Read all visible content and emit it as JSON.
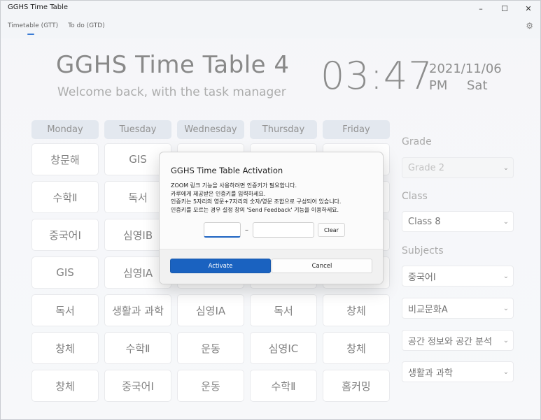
{
  "window": {
    "title": "GGHS Time Table",
    "minimize": "–",
    "maximize": "☐",
    "close": "✕"
  },
  "nav": {
    "tabs": [
      {
        "label": "Timetable (GTT)"
      },
      {
        "label": "To do (GTD)"
      }
    ],
    "settings_icon": "⚙"
  },
  "header": {
    "title": "GGHS Time Table 4",
    "subtitle": "Welcome back, with the task manager",
    "time": "03:47",
    "date": "2021/11/06",
    "ampm": "PM",
    "weekday": "Sat"
  },
  "timetable": {
    "days": [
      "Monday",
      "Tuesday",
      "Wednesday",
      "Thursday",
      "Friday"
    ],
    "rows": [
      [
        "창문해",
        "GIS",
        "",
        "",
        ""
      ],
      [
        "수학Ⅱ",
        "독서",
        "",
        "",
        ""
      ],
      [
        "중국어Ⅰ",
        "심영ⅠB",
        "",
        "",
        ""
      ],
      [
        "GIS",
        "심영ⅠA",
        "",
        "",
        ""
      ],
      [
        "독서",
        "생활과 과학",
        "심영ⅠA",
        "독서",
        "창체"
      ],
      [
        "창체",
        "수학Ⅱ",
        "운동",
        "심영ⅠC",
        "창체"
      ],
      [
        "창체",
        "중국어Ⅰ",
        "운동",
        "수학Ⅱ",
        "홈커밍"
      ]
    ]
  },
  "panel": {
    "grade_label": "Grade",
    "grade_value": "Grade 2",
    "class_label": "Class",
    "class_value": "Class 8",
    "subjects_label": "Subjects",
    "subjects": [
      "중국어Ⅰ",
      "비교문화A",
      "공간 정보와 공간 분석",
      "생활과 과학"
    ],
    "chevron": "⌄"
  },
  "dialog": {
    "title": "GGHS Time Table Activation",
    "lines": [
      "ZOOM 링크 기능을 사용하려면 인증키가 필요합니다.",
      "카루에게 제공받은 인증키를 입력하세요.",
      "인증키는 5자리의 영문+7자리의 숫자/영문 조합으로 구성되어 있습니다.",
      "인증키를 모르는 경우 설정 창의 'Send Feedback' 기능을 이용하세요."
    ],
    "key_part1": "",
    "key_part2": "",
    "separator": "–",
    "clear_label": "Clear",
    "activate_label": "Activate",
    "cancel_label": "Cancel"
  }
}
